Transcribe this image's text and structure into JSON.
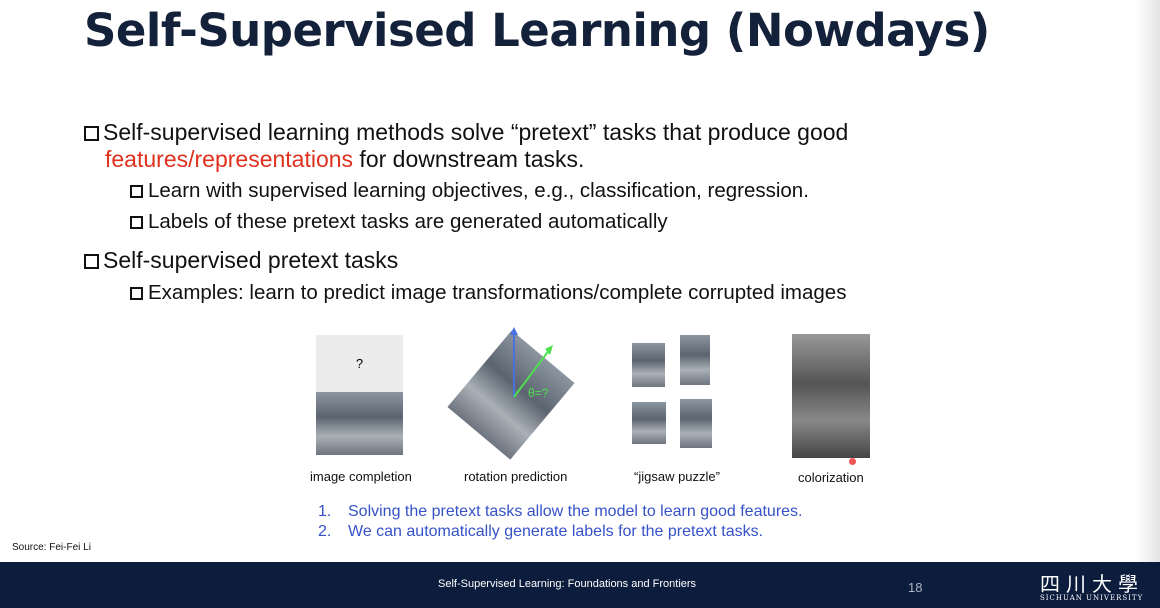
{
  "title": "Self-Supervised Learning (Nowdays)",
  "bullets": {
    "b1_text": "Self-supervised learning methods solve “pretext” tasks that produce good",
    "b1_highlight": "features/representations",
    "b1_rest": " for downstream tasks.",
    "b1_sub1": "Learn with supervised learning objectives, e.g., classification, regression.",
    "b1_sub2": "Labels of these pretext tasks are generated automatically",
    "b2_text": "Self-supervised pretext tasks",
    "b2_sub1": "Examples: learn to predict image transformations/complete corrupted images"
  },
  "figures": {
    "completion_caption": "image completion",
    "completion_mark": "?",
    "rotation_caption": "rotation prediction",
    "rotation_label": "θ=?",
    "jigsaw_caption": "“jigsaw puzzle”",
    "colorization_caption": "colorization"
  },
  "numbered": [
    {
      "n": "1.",
      "text": "Solving the pretext tasks allow the model to learn good features."
    },
    {
      "n": "2.",
      "text": "We can automatically generate labels for the pretext tasks."
    }
  ],
  "source": "Source: Fei-Fei Li",
  "footer": {
    "text": "Self-Supervised Learning: Foundations and Frontiers",
    "page": "18",
    "logo": "四川大學",
    "logo_sub": "SICHUAN UNIVERSITY"
  },
  "colors": {
    "accent_red": "#e0301e",
    "blue": "#3552c8",
    "footer": "#0b1c3d"
  }
}
